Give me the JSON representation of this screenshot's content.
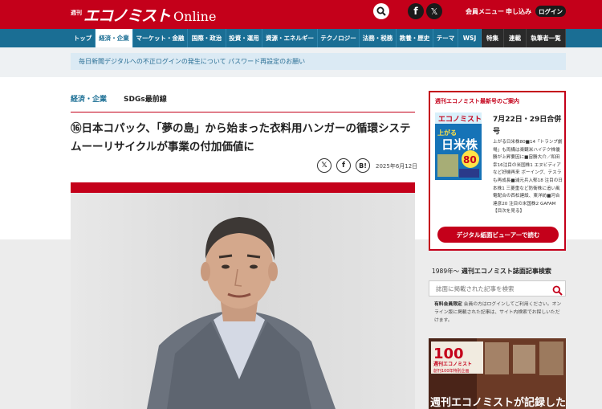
{
  "header": {
    "logo_mini": "週刊",
    "logo_jp": "エコノミスト",
    "logo_en": "Online",
    "links": [
      "会員メニュー",
      "申し込み"
    ],
    "login_label": "ログイン",
    "fb_glyph": "f",
    "x_glyph": "𝕏"
  },
  "nav": {
    "items": [
      "トップ",
      "経済・企業",
      "マーケット・金融",
      "国際・政治",
      "投資・運用",
      "資源・エネルギー",
      "テクノロジー",
      "法務・税務",
      "教養・歴史",
      "テーマ",
      "WSJ",
      "特集",
      "連載",
      "執筆者一覧"
    ]
  },
  "notice": "毎日新聞デジタルへの不正ログインの発生について パスワード再設定のお願い",
  "article": {
    "category": "経済・企業",
    "series": "SDGs最前線",
    "title": "⑯日本コパック、「夢の島」から始まった衣料用ハンガーの循環システムーーリサイクルが事業の付加価値に",
    "share_x": "𝕏",
    "share_fb": "f",
    "share_hatena": "B!",
    "date": "2025年6月12日"
  },
  "sidebar": {
    "magazine": {
      "heading": "週刊エコノミスト最新号のご案内",
      "issue": "7月22日・29日合併号",
      "cover_title": "エコノミスト",
      "cover_headline_1": "上がる",
      "cover_headline_2": "日米株",
      "cover_headline_3": "80",
      "description": "上がる日米株80■14「トランプ劇場」も両構は楽観米ハイテク株優勝が上昇要因に■宙勝大介／和田幸16注目の米国株1 エヌビディアなど好機再来 ボーイング、テスラも再成長■浦元兵入郁18 注目の日本株1 三菱重など防衛株に追い風 電配合の西松建設、東洋紡■河合達彦20 注目の米国株2 GAFAM【目次を見る】",
      "button": "デジタル紙面ビューアーで読む"
    },
    "search": {
      "heading_year": "1989年～",
      "heading": "週刊エコノミスト誌面記事検索",
      "placeholder": "誌面に掲載された記事を検索",
      "note_bold": "有料会員限定",
      "note": "会員の方はログインしてご利用ください。オンライン版に掲載された記事は、サイト内検索でお探しいただけます。"
    },
    "ad": {
      "badge_num": "100",
      "badge_line1": "週刊エコノミスト",
      "badge_line2": "創刊100年特別企画",
      "headline": "週刊エコノミストが記録した"
    }
  },
  "colors": {
    "brand_red": "#c4001a",
    "nav_blue": "#1a6e94",
    "notice_bg": "#dbeaf4"
  }
}
